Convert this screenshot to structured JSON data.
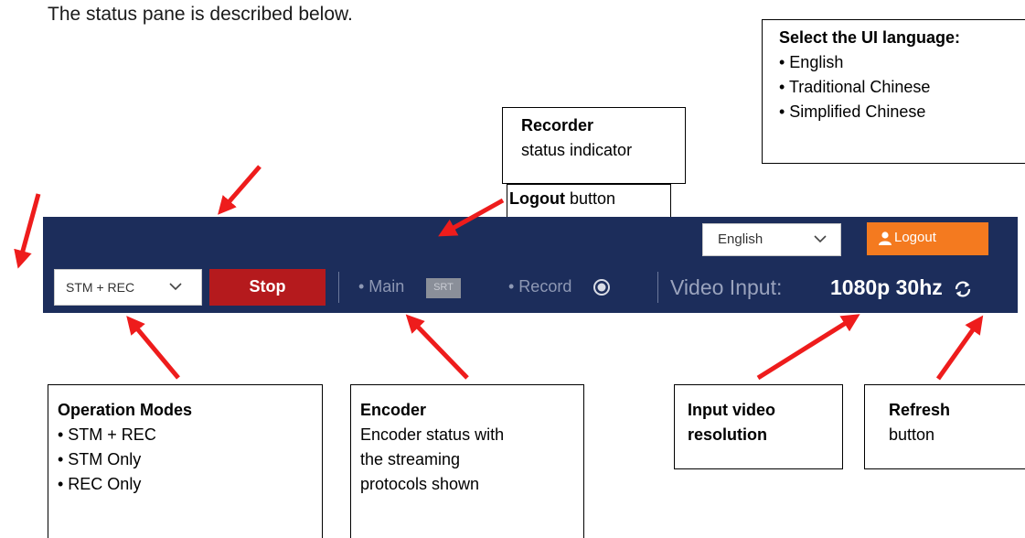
{
  "intro_text": "The status pane is described below.",
  "callouts": {
    "language": {
      "title": "Select the UI language:",
      "items": [
        "• English",
        "• Traditional Chinese",
        "• Simplified Chinese"
      ]
    },
    "recorder": {
      "title": "Recorder",
      "text": "status indicator"
    },
    "logout": {
      "title": "Logout",
      "text": " button"
    },
    "operation_modes": {
      "title": "Operation Modes",
      "items": [
        "• STM + REC",
        "• STM Only",
        "• REC Only"
      ]
    },
    "encoder": {
      "title": "Encoder",
      "lines": [
        "Encoder status with",
        "the streaming",
        "protocols shown"
      ]
    },
    "input_resolution": {
      "line1": "Input video",
      "line2": "resolution"
    },
    "refresh": {
      "title": "Refresh",
      "text": "button"
    }
  },
  "status_pane": {
    "language_value": "English",
    "logout_label": "Logout",
    "mode_value": "STM + REC",
    "stop_label": "Stop",
    "main_label": "• Main",
    "srt_badge": "SRT",
    "record_label": "• Record",
    "video_input_label": "Video Input:",
    "video_input_value": "1080p 30hz"
  },
  "colors": {
    "pane_bg": "#1c2d5b",
    "logout_bg": "#f47a1f",
    "stop_bg": "#b51a1d",
    "arrow": "#ee1c1c"
  },
  "icons": [
    "chevron-down-icon",
    "user-icon",
    "record-icon",
    "refresh-icon"
  ]
}
